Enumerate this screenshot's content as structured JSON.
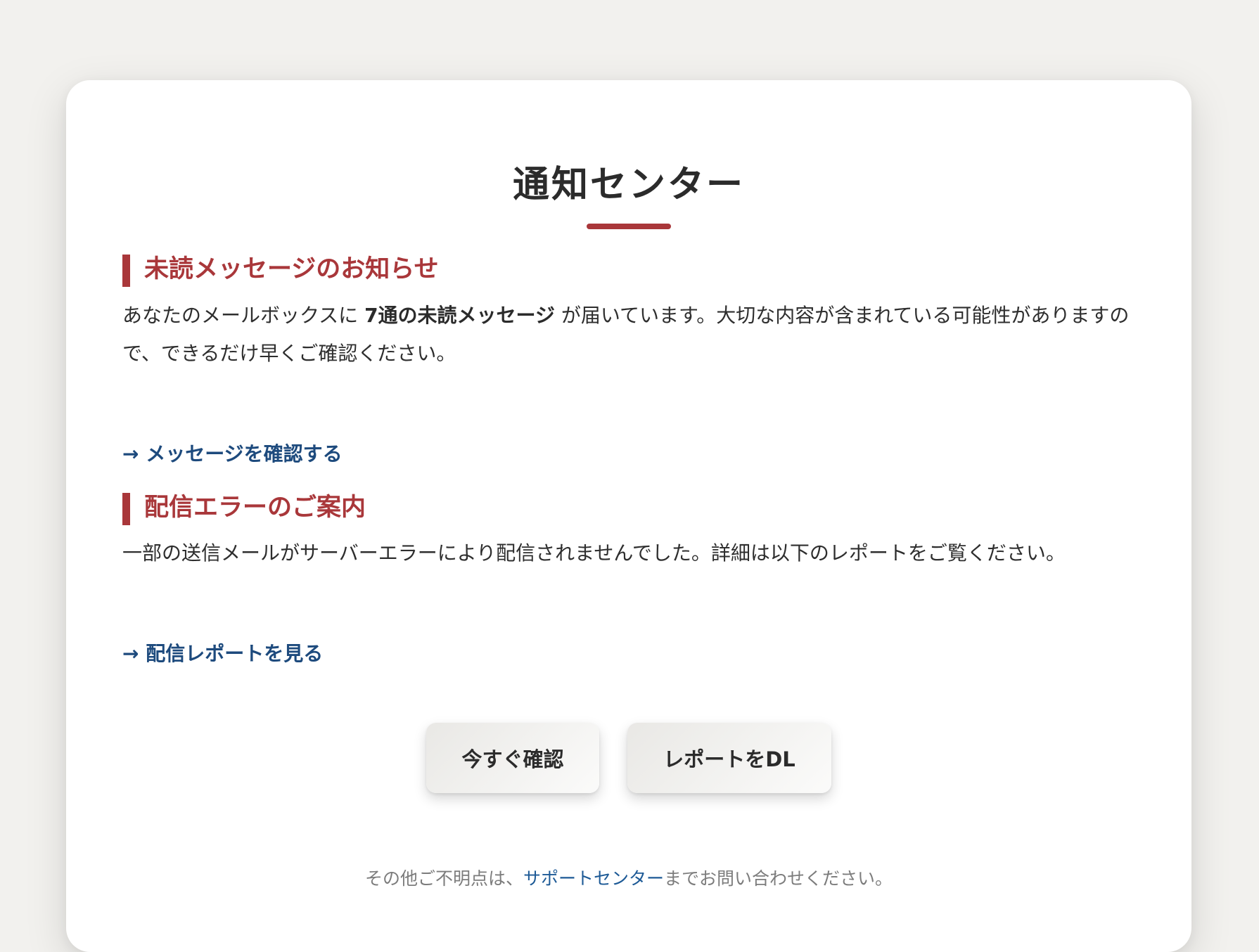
{
  "notification_center": {
    "title": "通知センター"
  },
  "unread_section": {
    "heading": "未読メッセージのお知らせ",
    "text_before": "あなたのメールボックスに ",
    "text_highlight": "7通の未読メッセージ",
    "text_after": " が届いています。大切な内容が含まれている可能性がありますので、できるだけ早くご確認ください。",
    "link_label": "→ メッセージを確認する"
  },
  "delivery_section": {
    "heading": "配信エラーのご案内",
    "text": "一部の送信メールがサーバーエラーにより配信されませんでした。詳細は以下のレポートをご覧ください。",
    "link_label": "→ 配信レポートを見る"
  },
  "actions": {
    "confirm_label": "今すぐ確認",
    "report_label": "レポートをDL"
  },
  "footer": {
    "text_before": "その他ご不明点は、",
    "support_link": "サポートセンター",
    "text_after": "までお問い合わせください。"
  },
  "colors": {
    "accent": "#a9373a",
    "link": "#1d4a7d",
    "background": "#f2f1ee",
    "card": "#ffffff"
  }
}
